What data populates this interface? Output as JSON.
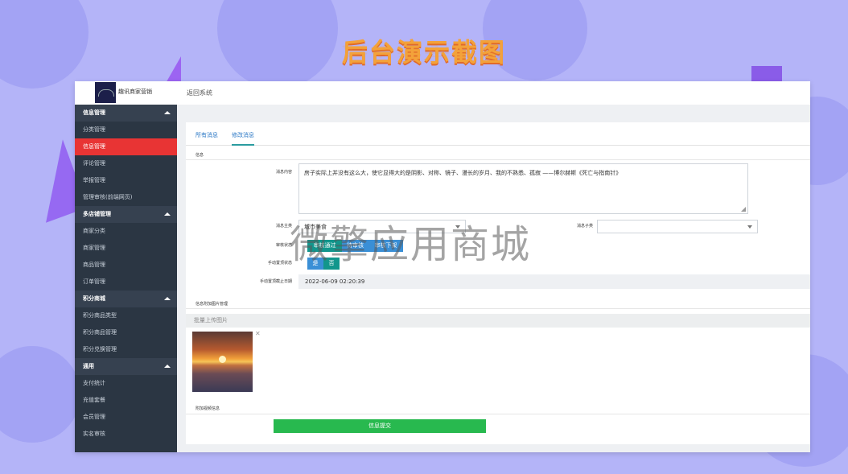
{
  "headline": "后台演示截图",
  "topbar": {
    "logo_text": "趣讯商家营销",
    "back_link": "返回系统"
  },
  "sidebar": {
    "groups": [
      {
        "title": "信息管理",
        "items": [
          "分类管理",
          "信息管理",
          "评论管理",
          "举报管理",
          "管理审核(前端网页)"
        ]
      },
      {
        "title": "多店铺管理",
        "items": [
          "商家分类",
          "商家管理",
          "商品管理",
          "订单管理"
        ]
      },
      {
        "title": "积分商城",
        "items": [
          "积分商品类型",
          "积分商品管理",
          "积分兑换管理"
        ]
      },
      {
        "title": "通用",
        "items": [
          "支付统计",
          "充值套餐",
          "会员管理",
          "实名审核"
        ]
      }
    ],
    "active_item": "信息管理"
  },
  "tabs": [
    {
      "label": "所有消息"
    },
    {
      "label": "修改消息"
    }
  ],
  "form": {
    "section_info": "信息",
    "label_content": "消息内容",
    "content_value": "房子实际上并没有这么大，使它显得大的是阴影、对称、镜子、漫长的岁月、我的不熟悉、孤寂 ——博尔赫斯《死亡与指南针》",
    "label_main_category": "消息主类",
    "main_category_value": "城市美食",
    "label_sub_category": "消息子类",
    "sub_category_value": "",
    "label_review_status": "审核状态",
    "review_options": [
      "审核通过",
      "待审核",
      "审核下架"
    ],
    "label_manual_top": "手动置顶状态",
    "manual_top_options": [
      "是",
      "否"
    ],
    "label_top_end_date": "手动置顶截止日期",
    "top_end_date_value": "2022-06-09 02:20:39",
    "section_images": "信息附加图片管理",
    "upload_label": "批量上传图片",
    "section_extra": "附加视频信息",
    "submit_label": "信息提交"
  },
  "watermark": "微擎应用商城",
  "colors": {
    "active": "#e83434",
    "primary_teal": "#12968c",
    "blue": "#3a8fd6",
    "submit": "#28b94f",
    "sidebar_bg": "#2b3643"
  }
}
